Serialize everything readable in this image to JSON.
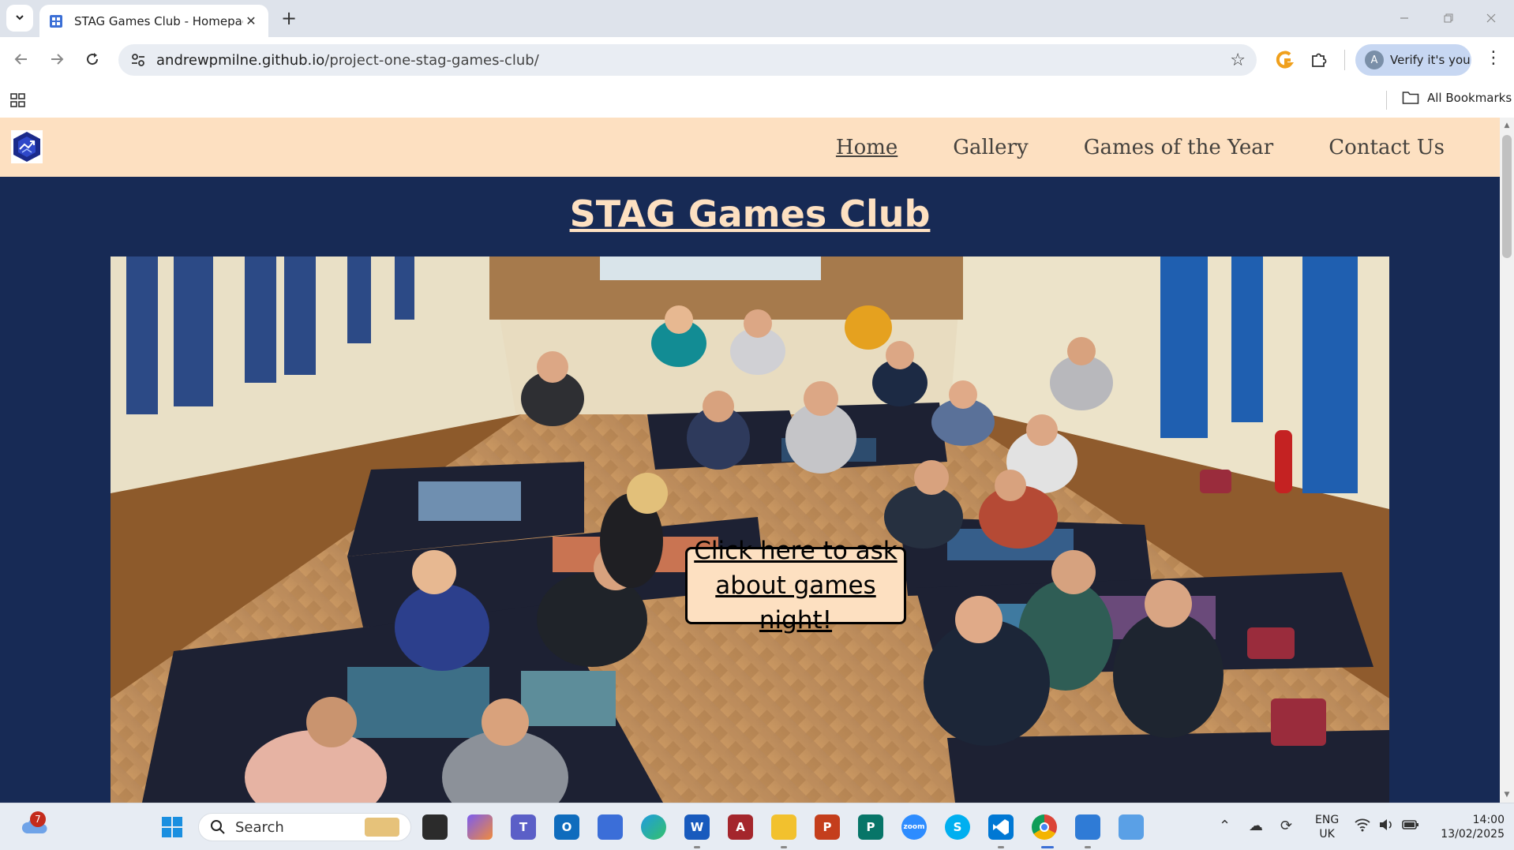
{
  "browser": {
    "tab_title": "STAG Games Club - Homepage",
    "tab_close": "✕",
    "new_tab": "+",
    "url_host": "andrewpmilne.github.io",
    "url_path": "/project-one-stag-games-club/",
    "profile_initial": "A",
    "verify_label": "Verify it's you",
    "bookmarks_label": "All Bookmarks"
  },
  "site": {
    "nav": [
      {
        "label": "Home",
        "active": true
      },
      {
        "label": "Gallery",
        "active": false
      },
      {
        "label": "Games of the Year",
        "active": false
      },
      {
        "label": "Contact Us",
        "active": false
      }
    ],
    "title": "STAG Games Club",
    "cta_line1": "Click here to ask",
    "cta_line2": "about games night!"
  },
  "taskbar": {
    "search_placeholder": "Search",
    "weather_badge": "7",
    "language_line1": "ENG",
    "language_line2": "UK",
    "time": "14:00",
    "date": "13/02/2025"
  },
  "colors": {
    "nav_bg": "#fde0c1",
    "page_bg": "#172a55",
    "title_color": "#fde0c1"
  }
}
